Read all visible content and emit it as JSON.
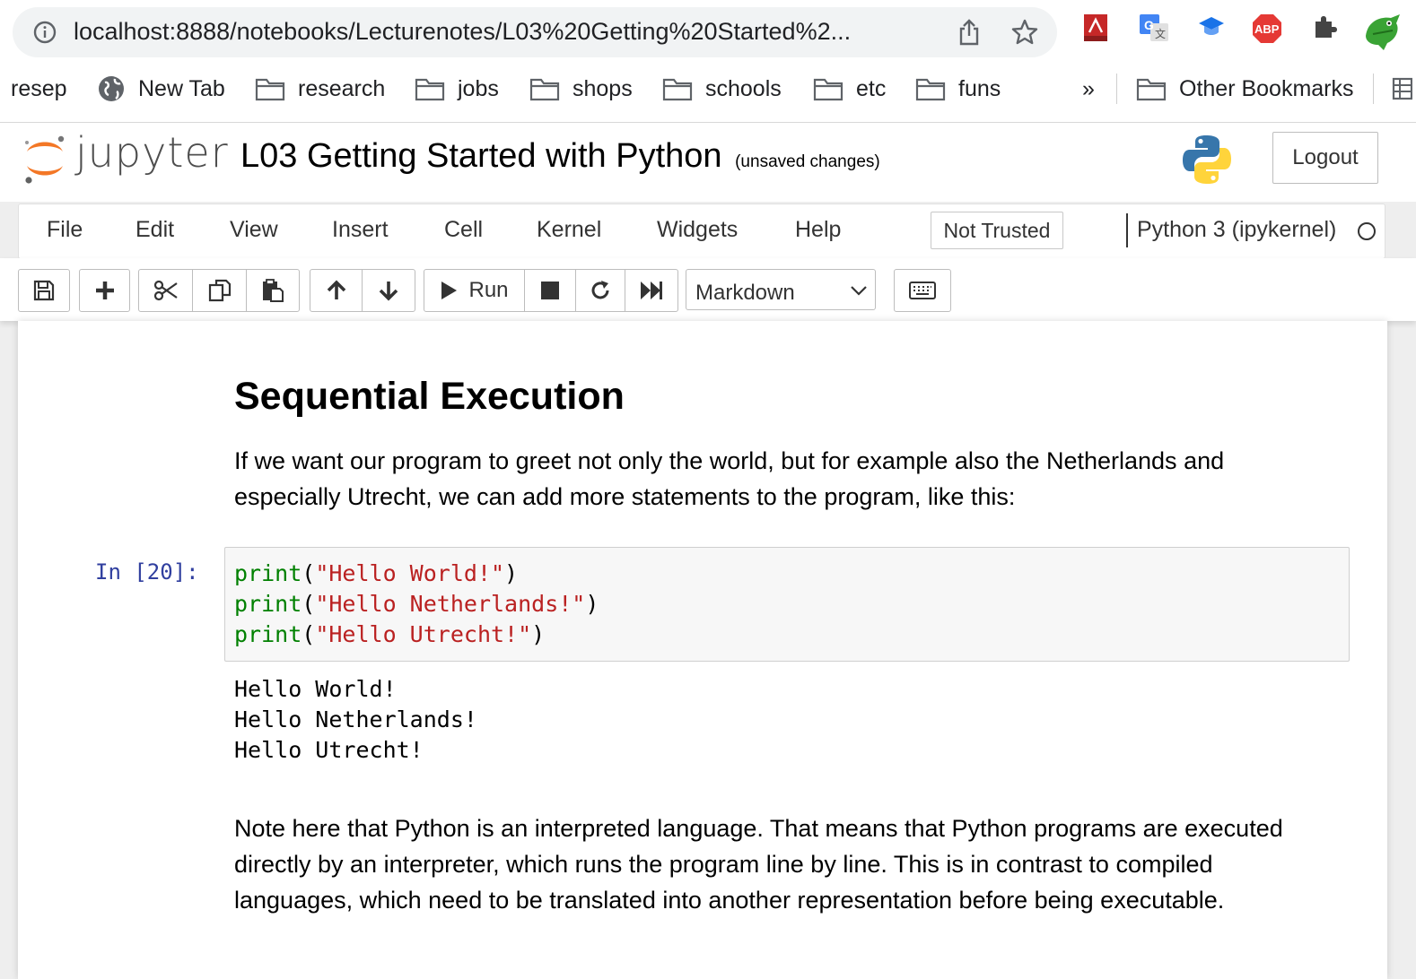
{
  "browser": {
    "url": "localhost:8888/notebooks/Lecturenotes/L03%20Getting%20Started%2...",
    "bookmarks": [
      {
        "label": "resep",
        "icon": "none"
      },
      {
        "label": "New Tab",
        "icon": "globe-icon"
      },
      {
        "label": "research",
        "icon": "folder-icon"
      },
      {
        "label": "jobs",
        "icon": "folder-icon"
      },
      {
        "label": "shops",
        "icon": "folder-icon"
      },
      {
        "label": "schools",
        "icon": "folder-icon"
      },
      {
        "label": "etc",
        "icon": "folder-icon"
      },
      {
        "label": "funs",
        "icon": "folder-icon"
      }
    ],
    "overflow_label": "»",
    "other_bookmarks": "Other Bookmarks",
    "extensions": [
      "pdf-extension-icon",
      "translate-extension-icon",
      "graduation-cap-extension-icon",
      "adblock-plus-icon",
      "puzzle-extensions-icon",
      "crocodile-avatar-icon"
    ],
    "abp_label": "ABP"
  },
  "jupyter": {
    "logo_text": "jupyter",
    "notebook_title": "L03 Getting Started with Python",
    "save_status": "(unsaved changes)",
    "logout_label": "Logout",
    "menu": [
      "File",
      "Edit",
      "View",
      "Insert",
      "Cell",
      "Kernel",
      "Widgets",
      "Help"
    ],
    "trust_label": "Not Trusted",
    "kernel_name": "Python 3 (ipykernel)",
    "toolbar": {
      "run_label": "Run",
      "cell_type": "Markdown"
    }
  },
  "notebook": {
    "heading": "Sequential Execution",
    "intro_line1": "If we want our program to greet not only the world, but for example also the Netherlands and",
    "intro_line2": "especially Utrecht, we can add more statements to the program, like this:",
    "cell": {
      "prompt": "In [20]:",
      "code": [
        {
          "fn": "print",
          "open": "(",
          "arg": "\"Hello World!\"",
          "close": ")"
        },
        {
          "fn": "print",
          "open": "(",
          "arg": "\"Hello Netherlands!\"",
          "close": ")"
        },
        {
          "fn": "print",
          "open": "(",
          "arg": "\"Hello Utrecht!\"",
          "close": ")"
        }
      ],
      "output": [
        "Hello World!",
        "Hello Netherlands!",
        "Hello Utrecht!"
      ]
    },
    "note_line1": "Note here that Python is an interpreted language. That means that Python programs are executed",
    "note_line2": "directly by an interpreter, which runs the program line by line. This is in contrast to compiled",
    "note_line3": "languages, which need to be translated into another representation before being executable."
  },
  "colors": {
    "prompt": "#303f9f",
    "keyword": "#008000",
    "string": "#ba2121",
    "jupyter_orange": "#f37726"
  }
}
